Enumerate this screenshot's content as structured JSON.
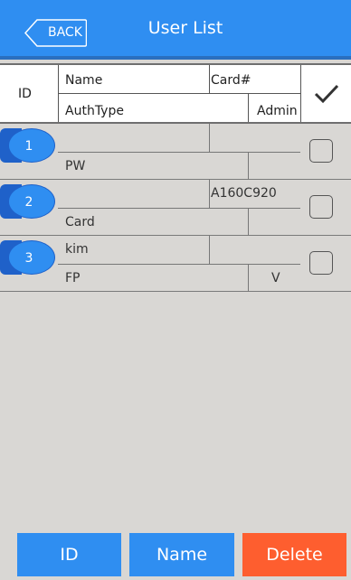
{
  "header": {
    "back_label": "BACK",
    "title": "User List"
  },
  "columns": {
    "id": "ID",
    "name": "Name",
    "card": "Card#",
    "authtype": "AuthType",
    "admin": "Admin"
  },
  "users": [
    {
      "id": "1",
      "name": "",
      "card": "",
      "authtype": "PW",
      "admin": "",
      "checked": false
    },
    {
      "id": "2",
      "name": "",
      "card": "A160C920",
      "authtype": "Card",
      "admin": "",
      "checked": false
    },
    {
      "id": "3",
      "name": "kim",
      "card": "",
      "authtype": "FP",
      "admin": "V",
      "checked": false
    }
  ],
  "buttons": {
    "id_label": "ID",
    "name_label": "Name",
    "delete_label": "Delete"
  },
  "colors": {
    "header_blue": "#2f8ef1",
    "badge_dark_blue": "#1f61c9",
    "delete_orange": "#fe5e2f",
    "background": "#d9d7d4"
  }
}
